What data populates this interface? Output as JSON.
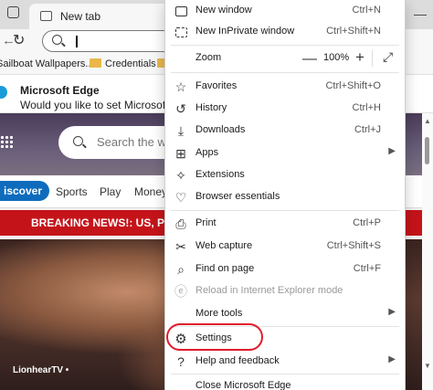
{
  "browser": {
    "tab_title": "New tab",
    "favorites_bar": [
      {
        "label": "Sailboat Wallpapers...",
        "icon": "page-icon"
      },
      {
        "label": "Credentials",
        "icon": "folder-icon"
      }
    ],
    "notification": {
      "title": "Microsoft Edge",
      "text": "Would you like to set Microsoft Ed"
    },
    "page_search_placeholder": "Search the we",
    "nav": {
      "discover": "iscover",
      "items": [
        "Sports",
        "Play",
        "Money"
      ]
    },
    "breaking_news": "BREAKING NEWS!: US, P",
    "photo_caption": "LionhearTV •"
  },
  "menu": {
    "items": [
      {
        "id": "new-window",
        "label": "New window",
        "shortcut": "Ctrl+N",
        "icon": "new-window-icon"
      },
      {
        "id": "new-inprivate",
        "label": "New InPrivate window",
        "shortcut": "Ctrl+Shift+N",
        "icon": "inprivate-icon"
      },
      {
        "id": "zoom",
        "label": "Zoom",
        "zoom_value": "100%",
        "minus": "—",
        "plus": "+",
        "icon": "zoom"
      },
      {
        "id": "favorites",
        "label": "Favorites",
        "shortcut": "Ctrl+Shift+O",
        "icon": "star-icon"
      },
      {
        "id": "history",
        "label": "History",
        "shortcut": "Ctrl+H",
        "icon": "history-icon"
      },
      {
        "id": "downloads",
        "label": "Downloads",
        "shortcut": "Ctrl+J",
        "icon": "download-icon"
      },
      {
        "id": "apps",
        "label": "Apps",
        "icon": "apps-icon"
      },
      {
        "id": "extensions",
        "label": "Extensions",
        "icon": "puzzle-icon"
      },
      {
        "id": "browser-essentials",
        "label": "Browser essentials",
        "icon": "heart-icon"
      },
      {
        "id": "print",
        "label": "Print",
        "shortcut": "Ctrl+P",
        "icon": "printer-icon"
      },
      {
        "id": "web-capture",
        "label": "Web capture",
        "shortcut": "Ctrl+Shift+S",
        "icon": "scissors-icon"
      },
      {
        "id": "find-on-page",
        "label": "Find on page",
        "shortcut": "Ctrl+F",
        "icon": "find-icon"
      },
      {
        "id": "reload-ie",
        "label": "Reload in Internet Explorer mode",
        "icon": "ie-icon",
        "disabled": true
      },
      {
        "id": "more-tools",
        "label": "More tools",
        "icon": "none"
      },
      {
        "id": "settings",
        "label": "Settings",
        "icon": "gear-icon"
      },
      {
        "id": "help",
        "label": "Help and feedback",
        "icon": "help-icon"
      },
      {
        "id": "close-edge",
        "label": "Close Microsoft Edge",
        "icon": "none"
      }
    ]
  },
  "colors": {
    "highlight": "#e01b2d",
    "breaking": "#c4141a",
    "discover": "#0f6cbd"
  }
}
